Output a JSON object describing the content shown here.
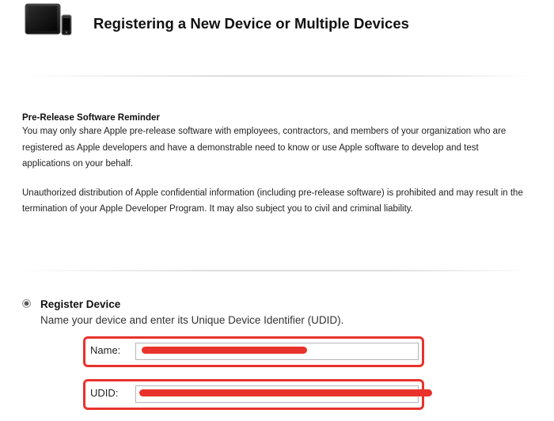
{
  "header": {
    "title": "Registering a New Device or Multiple Devices",
    "icon": "devices-icon"
  },
  "reminder": {
    "title": "Pre-Release Software Reminder",
    "paragraph1": "You may only share Apple pre-release software with employees, contractors, and members of your organization who are registered as Apple developers and have a demonstrable need to know or use Apple software to develop and test applications on your behalf.",
    "paragraph2": "Unauthorized distribution of Apple confidential information (including pre-release software) is prohibited and may result in the termination of your Apple Developer Program. It may also subject you to civil and criminal liability."
  },
  "register": {
    "selected": true,
    "title": "Register Device",
    "description": "Name your device and enter its Unique Device Identifier (UDID)."
  },
  "fields": {
    "name": {
      "label": "Name:",
      "value": ""
    },
    "udid": {
      "label": "UDID:",
      "value": ""
    }
  },
  "colors": {
    "highlight": "#e8332c",
    "divider": "#dcdcdc"
  }
}
